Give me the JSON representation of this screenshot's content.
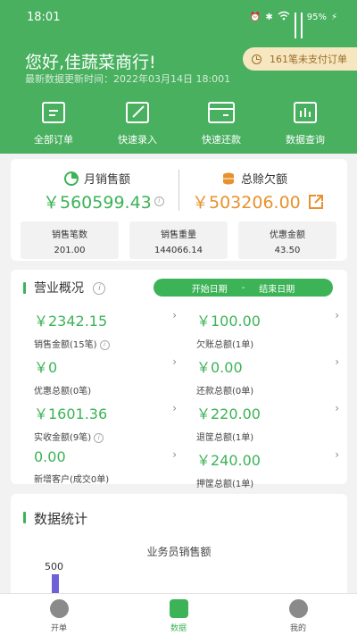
{
  "status_bar": {
    "time": "18:01",
    "battery": "95%"
  },
  "header": {
    "greeting": "您好,佳蔬菜商行!",
    "update_time": "最新数据更新时间：2022年03月14日 18:001",
    "unpaid_badge": "161笔未支付订单"
  },
  "quick_actions": [
    {
      "label": "全部订单",
      "icon": "document-icon"
    },
    {
      "label": "快速录入",
      "icon": "edit-icon"
    },
    {
      "label": "快速还款",
      "icon": "wallet-icon"
    },
    {
      "label": "数据查询",
      "icon": "bar-chart-icon"
    }
  ],
  "summary": {
    "monthly_sales_label": "月销售额",
    "monthly_sales_value": "￥560599.43",
    "total_debt_label": "总赊欠额",
    "total_debt_value": "￥503206.00",
    "stats": [
      {
        "label": "销售笔数",
        "value": "201.00"
      },
      {
        "label": "销售重量",
        "value": "144066.14"
      },
      {
        "label": "优惠金额",
        "value": "43.50"
      }
    ]
  },
  "operations": {
    "title": "营业概况",
    "start_date": "开始日期",
    "separator": "-",
    "end_date": "结束日期",
    "items": [
      {
        "value": "￥2342.15",
        "label": "销售金额(15笔)"
      },
      {
        "value": "￥100.00",
        "label": "欠账总额(1单)"
      },
      {
        "value": "￥0",
        "label": "优惠总额(0笔)"
      },
      {
        "value": "￥0.00",
        "label": "还款总额(0单)"
      },
      {
        "value": "￥1601.36",
        "label": "实收金额(9笔)"
      },
      {
        "value": "￥220.00",
        "label": "退筐总额(1单)"
      },
      {
        "value": "0.00",
        "label": "新增客户(成交0单)"
      },
      {
        "value": "￥240.00",
        "label": "押筐总额(1单)"
      }
    ]
  },
  "stats": {
    "title": "数据统计",
    "chart_data": {
      "type": "bar",
      "title": "业务员销售额",
      "categories": [],
      "values": [
        500
      ],
      "yticks": [
        "500"
      ]
    }
  },
  "tabbar": [
    {
      "label": "开单",
      "active": false
    },
    {
      "label": "数据",
      "active": true
    },
    {
      "label": "我的",
      "active": false
    }
  ],
  "colors": {
    "primary": "#48b05f",
    "accent_orange": "#e8912d",
    "bar": "#6f61d6"
  }
}
